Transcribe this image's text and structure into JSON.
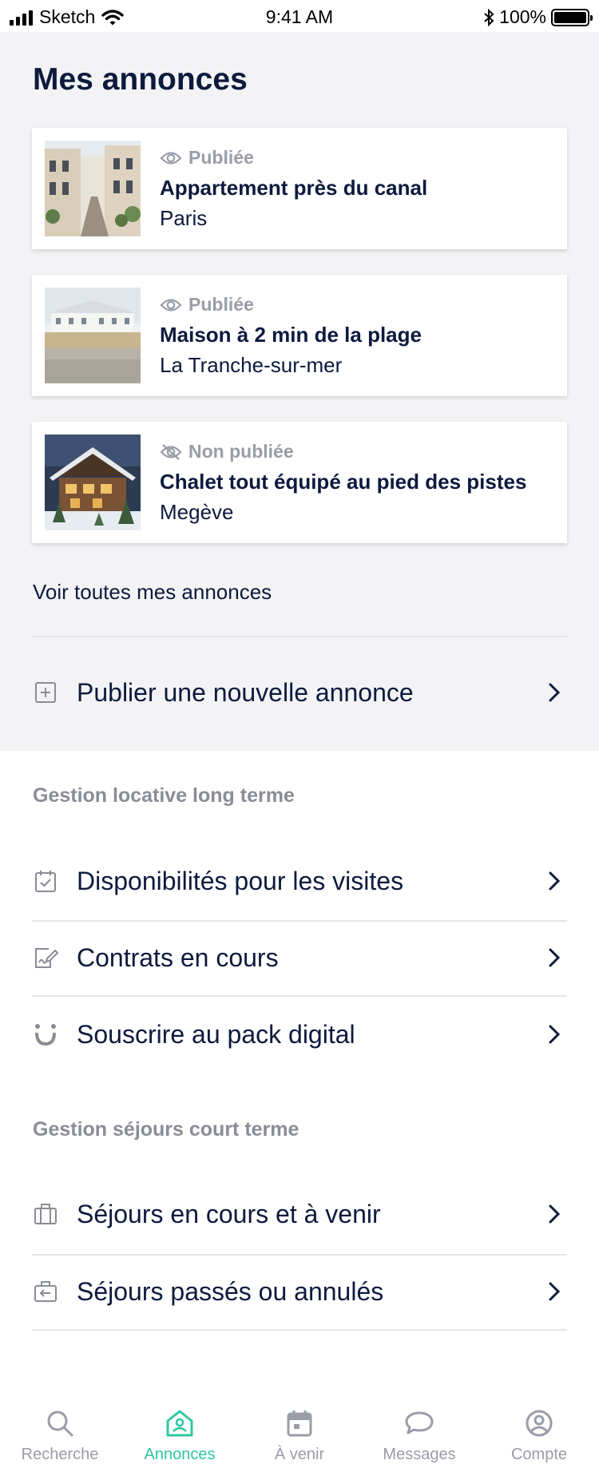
{
  "status_bar": {
    "carrier": "Sketch",
    "time": "9:41 AM",
    "battery": "100%"
  },
  "page_title": "Mes annonces",
  "listings": [
    {
      "status": "Publiée",
      "title": "Appartement près du canal",
      "location": "Paris",
      "published": true
    },
    {
      "status": "Publiée",
      "title": "Maison à 2 min de la plage",
      "location": "La Tranche-sur-mer",
      "published": true
    },
    {
      "status": "Non publiée",
      "title": "Chalet tout équipé au pied des pistes",
      "location": "Megève",
      "published": false
    }
  ],
  "see_all": "Voir toutes mes annonces",
  "publish_new": "Publier une nouvelle annonce",
  "long_term": {
    "title": "Gestion locative long terme",
    "items": [
      {
        "label": "Disponibilités pour les visites",
        "icon": "calendar-check-icon"
      },
      {
        "label": "Contrats en cours",
        "icon": "contract-sign-icon"
      },
      {
        "label": "Souscrire au pack digital",
        "icon": "pack-digital-icon"
      }
    ]
  },
  "short_term": {
    "title": "Gestion séjours court terme",
    "items": [
      {
        "label": "Séjours en cours et à venir",
        "icon": "suitcase-icon"
      },
      {
        "label": "Séjours passés ou annulés",
        "icon": "suitcase-return-icon"
      }
    ]
  },
  "tabs": [
    {
      "label": "Recherche",
      "icon": "search-icon"
    },
    {
      "label": "Annonces",
      "icon": "home-icon",
      "active": true
    },
    {
      "label": "À venir",
      "icon": "calendar-icon"
    },
    {
      "label": "Messages",
      "icon": "chat-icon"
    },
    {
      "label": "Compte",
      "icon": "user-icon"
    }
  ],
  "colors": {
    "accent": "#2fc7a3",
    "text": "#0d1a3d",
    "muted": "#9a9ca8",
    "gray_bg": "#f3f3f5"
  }
}
